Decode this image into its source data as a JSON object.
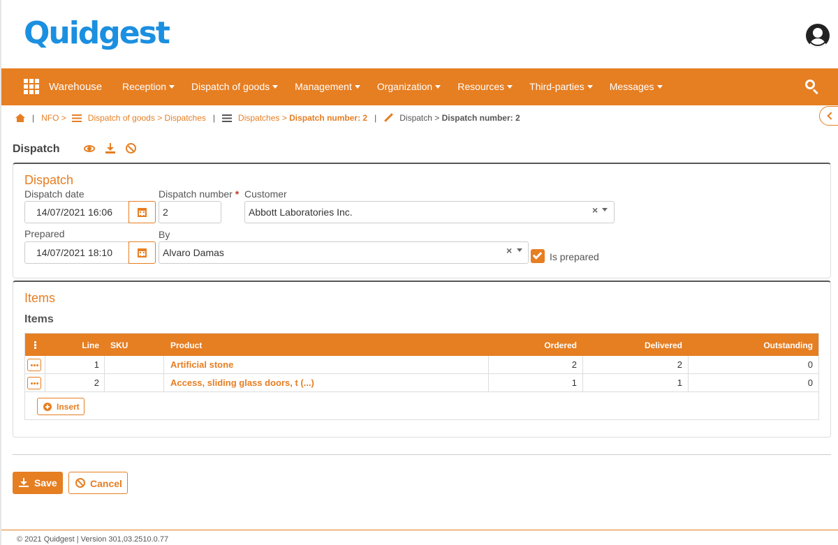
{
  "header": {
    "logo": "Quidgest"
  },
  "nav": {
    "brand": "Warehouse",
    "items": [
      "Reception",
      "Dispatch of goods",
      "Management",
      "Organization",
      "Resources",
      "Third-parties",
      "Messages"
    ]
  },
  "breadcrumb": {
    "nfo": "NFO >",
    "dispatch_of_goods": "Dispatch of goods > Dispatches",
    "dispatches_label": "Dispatches >",
    "dispatches_current": "Dispatch number: 2",
    "dispatch_label": "Dispatch >",
    "dispatch_current": "Dispatch number: 2"
  },
  "page": {
    "title": "Dispatch"
  },
  "dispatch_panel": {
    "title": "Dispatch",
    "dispatch_date_label": "Dispatch date",
    "dispatch_date_value": "14/07/2021 16:06",
    "dispatch_number_label": "Dispatch number",
    "required_mark": "*",
    "dispatch_number_value": "2",
    "customer_label": "Customer",
    "customer_value": "Abbott Laboratories Inc.",
    "prepared_label": "Prepared",
    "prepared_value": "14/07/2021 18:10",
    "by_label": "By",
    "by_value": "Alvaro Damas",
    "is_prepared_label": "Is prepared",
    "is_prepared_checked": true
  },
  "items_panel": {
    "title": "Items",
    "subtitle": "Items",
    "columns": {
      "line": "Line",
      "sku": "SKU",
      "product": "Product",
      "ordered": "Ordered",
      "delivered": "Delivered",
      "outstanding": "Outstanding"
    },
    "rows": [
      {
        "line": "1",
        "sku": "",
        "product": "Artificial stone",
        "ordered": "2",
        "delivered": "2",
        "outstanding": "0"
      },
      {
        "line": "2",
        "sku": "",
        "product": "Access, sliding glass doors, t (...)",
        "ordered": "1",
        "delivered": "1",
        "outstanding": "0"
      }
    ],
    "insert_label": "Insert"
  },
  "actions": {
    "save_label": "Save",
    "cancel_label": "Cancel"
  },
  "footer": {
    "text": "© 2021 Quidgest | Version 301,03.2510.0.77"
  },
  "colors": {
    "accent": "#e67e22",
    "logo": "#1b8fe0"
  },
  "icons": [
    "apps-grid-icon",
    "search-icon",
    "user-avatar-icon",
    "home-icon",
    "list-icon",
    "pencil-icon",
    "chevron-left-icon",
    "eye-icon",
    "download-icon",
    "ban-icon",
    "calendar-icon",
    "checkmark-icon",
    "plus-circle-icon",
    "ellipsis-icon"
  ]
}
